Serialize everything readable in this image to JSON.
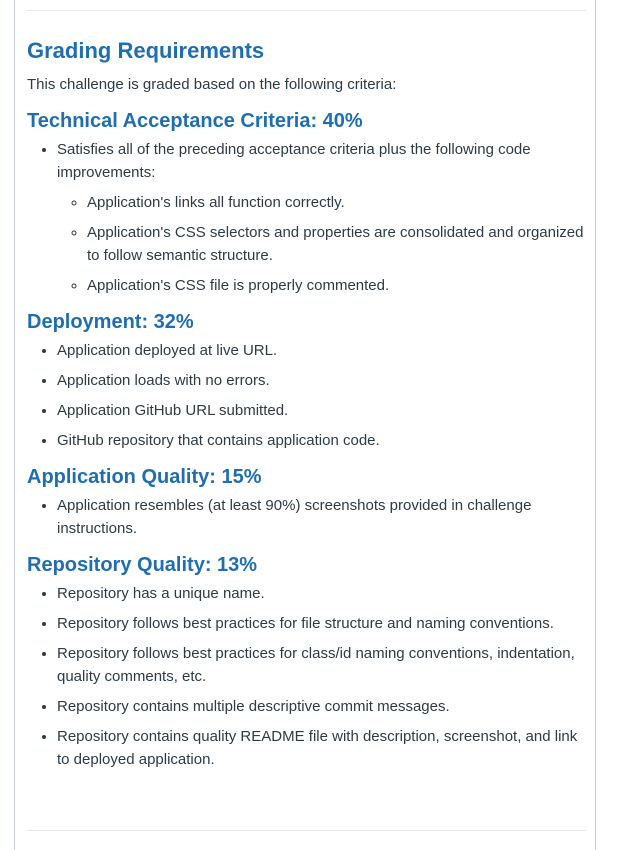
{
  "title": "Grading Requirements",
  "intro": "This challenge is graded based on the following criteria:",
  "sections": [
    {
      "heading": "Technical Acceptance Criteria: 40%",
      "items": [
        "Satisfies all of the preceding acceptance criteria plus the following code improvements:"
      ],
      "sub_items": [
        "Application's links all function correctly.",
        "Application's CSS selectors and properties are consolidated and organized to follow semantic structure.",
        "Application's CSS file is properly commented."
      ]
    },
    {
      "heading": "Deployment: 32%",
      "items": [
        "Application deployed at live URL.",
        "Application loads with no errors.",
        "Application GitHub URL submitted.",
        "GitHub repository that contains application code."
      ]
    },
    {
      "heading": "Application Quality: 15%",
      "items": [
        "Application resembles (at least 90%) screenshots provided in challenge instructions."
      ]
    },
    {
      "heading": "Repository Quality: 13%",
      "items": [
        "Repository has a unique name.",
        "Repository follows best practices for file structure and naming conventions.",
        "Repository follows best practices for class/id naming conventions, indentation, quality comments, etc.",
        "Repository contains multiple descriptive commit messages.",
        "Repository contains quality README file with description, screenshot, and link to deployed application."
      ]
    }
  ]
}
